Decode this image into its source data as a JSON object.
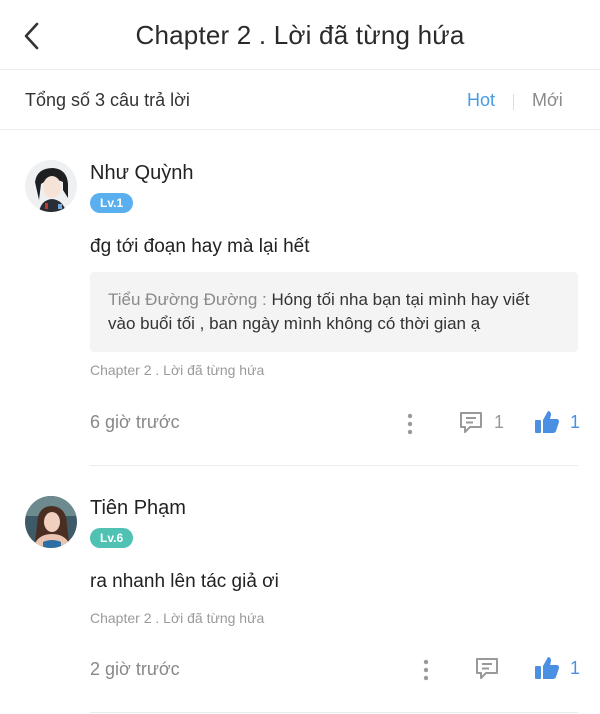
{
  "header": {
    "title": "Chapter 2 . Lời đã từng hứa"
  },
  "filter": {
    "total": "Tổng số 3 câu trả lời",
    "sort_hot": "Hot",
    "sort_new": "Mới"
  },
  "comments": [
    {
      "user": "Như Quỳnh",
      "level": "Lv.1",
      "text": "đg tới đoạn hay mà lại hết",
      "reply": {
        "author": "Tiểu Đường Đường :",
        "text": "Hóng tối nha bạn tại mình hay viết vào buổi tối , ban ngày mình không có thời gian ạ"
      },
      "chapter": "Chapter 2 . Lời đã từng hứa",
      "time": "6 giờ trước",
      "reply_count": "1",
      "like_count": "1"
    },
    {
      "user": "Tiên Phạm",
      "level": "Lv.6",
      "text": "ra nhanh lên tác giả ơi",
      "chapter": "Chapter 2 . Lời đã từng hứa",
      "time": "2 giờ trước",
      "like_count": "1"
    }
  ],
  "colors": {
    "accent": "#4a9be8",
    "like": "#4a90e2",
    "level_blue": "#5ab0ef",
    "level_teal": "#4fc2b3"
  }
}
